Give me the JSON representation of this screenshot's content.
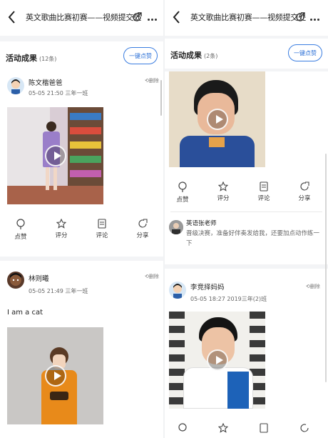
{
  "colors": {
    "accent": "#2a6fd6",
    "background": "#ffffff",
    "divider": "#f3f4f6"
  },
  "left": {
    "nav": {
      "title": "英文歌曲比赛初赛——视频提交处"
    },
    "section": {
      "title": "活动成果",
      "count": "(12条)",
      "action": "一键点赞"
    },
    "posts": [
      {
        "author": "陈文楷爸爸",
        "meta": "05-05 21:50 三年一班",
        "delete": "删除",
        "actions": {
          "like": "点赞",
          "rate": "评分",
          "comment": "评论",
          "share": "分享"
        }
      },
      {
        "author": "林则曦",
        "meta": "05-05 21:49 三年一班",
        "delete": "删除",
        "text": "I am a cat"
      }
    ]
  },
  "right": {
    "nav": {
      "title": "英文歌曲比赛初赛——视频提交处"
    },
    "section": {
      "title": "活动成果",
      "count": "(2条)",
      "action": "一键点赞"
    },
    "actions": {
      "like": "点赞",
      "rate": "评分",
      "comment": "评论",
      "share": "分享"
    },
    "comment": {
      "author": "英语张老师",
      "text": "晋级决赛，准备好伴奏发给我，还要加点动作练一下"
    },
    "post": {
      "author": "李竞择妈妈",
      "meta": "05-05 18:27 2019三年(2)班",
      "delete": "删除"
    }
  }
}
